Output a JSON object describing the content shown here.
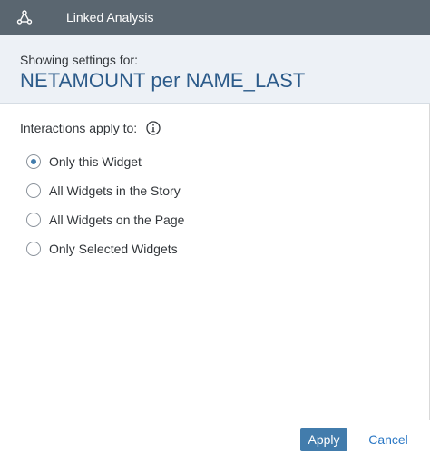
{
  "dialog": {
    "title": "Linked Analysis",
    "title_icon": "linked-analysis-icon"
  },
  "subheader": {
    "label": "Showing settings for:",
    "heading": "NETAMOUNT per NAME_LAST"
  },
  "interactions": {
    "label": "Interactions apply to:",
    "info_icon": "info-icon",
    "selected": "Only this Widget",
    "options": [
      {
        "label": "Only this Widget",
        "checked": true
      },
      {
        "label": "All Widgets in the Story",
        "checked": false
      },
      {
        "label": "All Widgets on the Page",
        "checked": false
      },
      {
        "label": "Only Selected Widgets",
        "checked": false
      }
    ]
  },
  "footer": {
    "apply_label": "Apply",
    "cancel_label": "Cancel"
  },
  "colors": {
    "titlebar": "#5a6670",
    "subheader_bg": "#edf1f6",
    "heading": "#2c5b8a",
    "accent": "#427cac",
    "link": "#2b78c5"
  }
}
